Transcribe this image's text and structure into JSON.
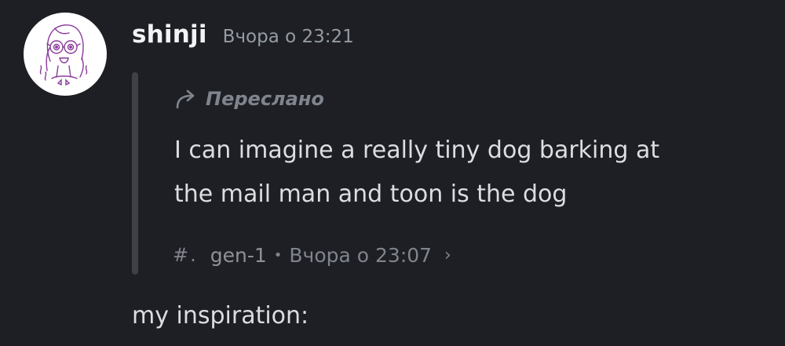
{
  "message": {
    "author": "shinji",
    "timestamp": "Вчора о 23:21",
    "forwarded": {
      "label": "Переслано",
      "text_lines": [
        "I can imagine a really tiny dog barking at",
        "the mail man and toon is the dog"
      ],
      "source": {
        "channel_icon": "#.",
        "channel": "gen-1",
        "separator": "•",
        "timestamp": "Вчора о 23:07",
        "chevron": "›"
      }
    },
    "content": "my inspiration:"
  },
  "colors": {
    "background": "#1e1f24",
    "username": "#f2f3f5",
    "muted": "#80848e",
    "text": "#dbdee1",
    "bar": "#3f4147"
  },
  "icons": {
    "avatar": "cartoon-girl-with-glasses-avatar",
    "forward": "forward-arrow-icon",
    "chevron": "chevron-right-icon"
  }
}
